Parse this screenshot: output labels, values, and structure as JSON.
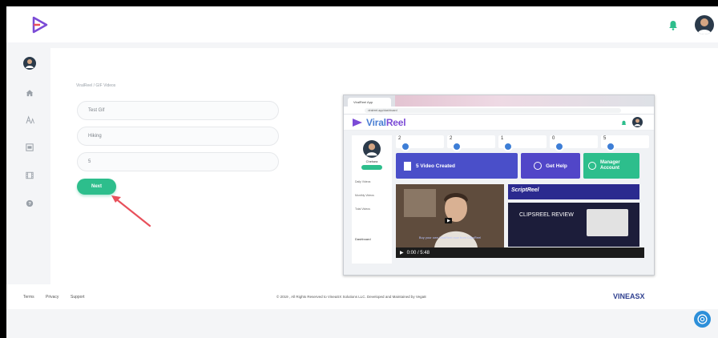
{
  "colors": {
    "accent": "#2dbe8c",
    "annotation_arrow": "#e8505b",
    "brand_purple": "#7b4bd6",
    "brand_blue": "#3d7ed6"
  },
  "header": {
    "logo_icon": "logo-icon",
    "notification_icon": "bell-icon",
    "avatar_icon": "user-avatar"
  },
  "sidebar": {
    "items": [
      {
        "icon": "user-avatar"
      },
      {
        "icon": "home-icon"
      },
      {
        "icon": "font-icon"
      },
      {
        "icon": "media-icon"
      },
      {
        "icon": "film-icon"
      },
      {
        "icon": "help-icon"
      }
    ]
  },
  "main": {
    "breadcrumb": "ViralReel / GIF Videos",
    "fields": {
      "title": "Test Gif",
      "keyword": "Hiking",
      "count": "5"
    },
    "next_label": "Next"
  },
  "preview": {
    "tab_title": "ViralReel App",
    "url": "viralreel.app/dashboard",
    "brand_left": "Viral",
    "brand_right": "Reel",
    "profile_name": "Chelsea",
    "side_items": [
      "Daily Videos",
      "Monthly Videos",
      "Total Videos",
      "Dashboard"
    ],
    "stats": [
      "2",
      "2",
      "1",
      "0",
      "5"
    ],
    "cards": {
      "videos": "5 Video Created",
      "help": "Get Help",
      "manager": "Manager Account"
    },
    "video_caption": "Buy your own ViralReel now from ClipsReel",
    "promo_right": "CLIPSREEL REVIEW",
    "promo_script": "ScriptReel",
    "video_time": "0:00 / 5:48"
  },
  "footer": {
    "links": [
      "Terms",
      "Privacy",
      "Support"
    ],
    "copyright": "© 2019 , All Rights Reserved to VineaSX Solutions LLC. Developed and Maintained by Vega8",
    "brand_logo": "VINEASX"
  },
  "chat_icon": "chat-support-icon"
}
